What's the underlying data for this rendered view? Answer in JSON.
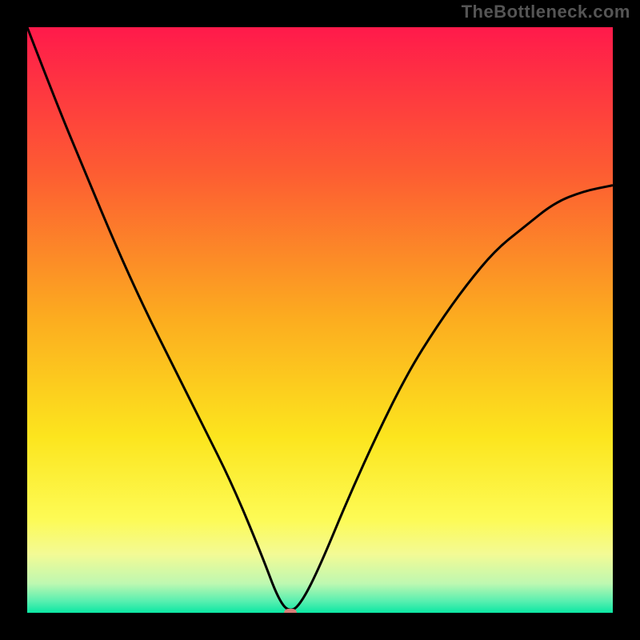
{
  "watermark": "TheBottleneck.com",
  "chart_data": {
    "type": "line",
    "title": "",
    "xlabel": "",
    "ylabel": "",
    "xlim": [
      0,
      100
    ],
    "ylim": [
      0,
      100
    ],
    "grid": false,
    "legend": false,
    "background_gradient": {
      "stops": [
        {
          "offset": 0.0,
          "color": "#ff1a4b"
        },
        {
          "offset": 0.25,
          "color": "#fd5d32"
        },
        {
          "offset": 0.5,
          "color": "#fcad1f"
        },
        {
          "offset": 0.7,
          "color": "#fce51e"
        },
        {
          "offset": 0.84,
          "color": "#fdfb55"
        },
        {
          "offset": 0.9,
          "color": "#f3fa95"
        },
        {
          "offset": 0.95,
          "color": "#bef8b1"
        },
        {
          "offset": 0.98,
          "color": "#59efb0"
        },
        {
          "offset": 1.0,
          "color": "#0be7a3"
        }
      ]
    },
    "series": [
      {
        "name": "bottleneck-curve",
        "color": "#000000",
        "x": [
          0,
          5,
          10,
          15,
          20,
          25,
          30,
          35,
          40,
          43,
          45,
          47,
          50,
          55,
          60,
          65,
          70,
          75,
          80,
          85,
          90,
          95,
          100
        ],
        "y": [
          100,
          87,
          75,
          63,
          52,
          42,
          32,
          22,
          10,
          2,
          0,
          2,
          8,
          20,
          31,
          41,
          49,
          56,
          62,
          66,
          70,
          72,
          73
        ]
      }
    ],
    "marker": {
      "name": "optimal-point",
      "x": 45,
      "y": 0,
      "color": "#d87d78"
    },
    "green_band": {
      "y_start": 0,
      "y_end": 4
    }
  }
}
